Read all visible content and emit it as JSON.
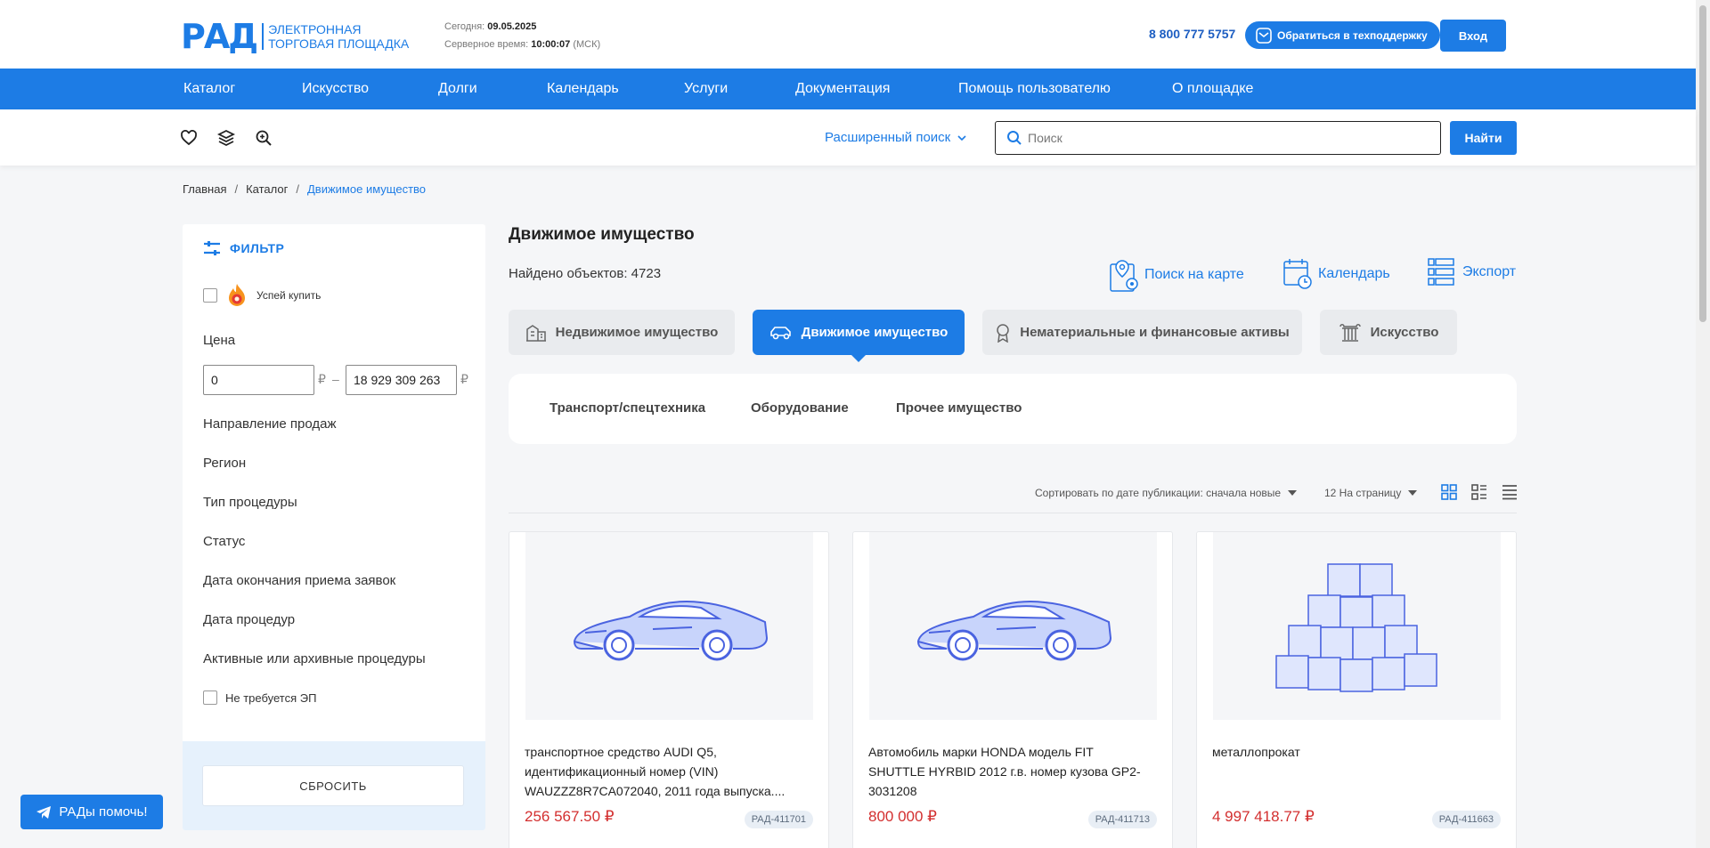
{
  "header": {
    "logo_mark": "РАД",
    "logo_line1": "ЭЛЕКТРОННАЯ",
    "logo_line2": "ТОРГОВАЯ ПЛОЩАДКА",
    "today_label": "Сегодня:",
    "today_value": "09.05.2025",
    "server_label": "Серверное время:",
    "server_value": "10:00:07",
    "server_tz": "(МСК)",
    "phone": "8 800 777 5757",
    "support_label": "Обратиться в техподдержку",
    "login_label": "Вход"
  },
  "nav": [
    "Каталог",
    "Искусство",
    "Долги",
    "Календарь",
    "Услуги",
    "Документация",
    "Помощь пользователю",
    "О площадке"
  ],
  "toolbar": {
    "advanced_search": "Расширенный поиск",
    "search_placeholder": "Поиск",
    "find_label": "Найти"
  },
  "breadcrumb": [
    "Главная",
    "Каталог",
    "Движимое имущество"
  ],
  "filter": {
    "title": "ФИЛЬТР",
    "hurry_label": "Успей купить",
    "price_label": "Цена",
    "price_from": "0",
    "price_to": "18 929 309 263",
    "currency": "₽",
    "dash": "–",
    "fields": [
      "Направление продаж",
      "Регион",
      "Тип процедуры",
      "Статус",
      "Дата окончания приема заявок",
      "Дата процедур",
      "Активные или архивные процедуры"
    ],
    "no_ep_label": "Не требуется ЭП",
    "reset_label": "СБРОСИТЬ"
  },
  "help_button": "РАДы помочь!",
  "main": {
    "title": "Движимое имущество",
    "found_text": "Найдено объектов: 4723",
    "links": [
      "Поиск на карте",
      "Календарь",
      "Экспорт"
    ],
    "categories": [
      "Недвижимое имущество",
      "Движимое имущество",
      "Нематериальные и финансовые активы",
      "Искусство"
    ],
    "subcategories": [
      "Транспорт/спецтехника",
      "Оборудование",
      "Прочее имущество"
    ],
    "sort_label": "Сортировать по дате публикации: сначала новые",
    "per_page_label": "12 На страницу"
  },
  "cards": [
    {
      "title": "транспортное средство AUDI Q5, идентификационный номер (VIN) WAUZZZ8R7CA072040, 2011 года выпуска....",
      "price": "256 567.50 ₽",
      "code": "РАД-411701",
      "image": "car"
    },
    {
      "title": "Автомобиль марки HONDA модель FIT SHUTTLE HYRBID 2012 г.в. номер кузова GP2-3031208",
      "price": "800 000 ₽",
      "code": "РАД-411713",
      "image": "car"
    },
    {
      "title": "металлопрокат",
      "price": "4 997 418.77 ₽",
      "code": "РАД-411663",
      "image": "boxes"
    }
  ],
  "colors": {
    "accent": "#1d7ce5",
    "price": "#d32f2f"
  }
}
